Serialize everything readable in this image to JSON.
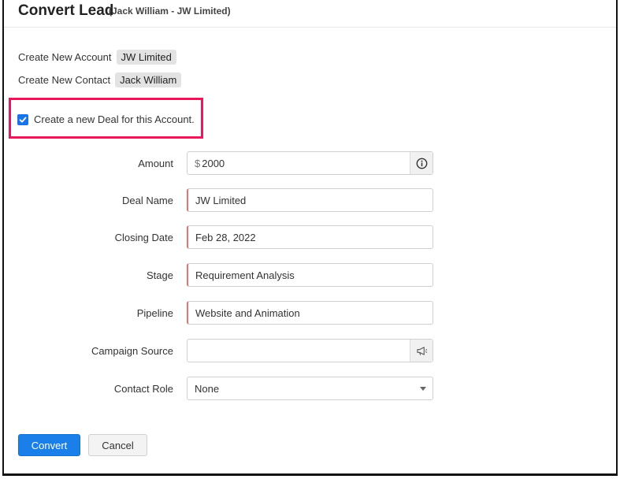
{
  "header": {
    "title": "Convert Lead",
    "subtitle": "(Jack William - JW Limited)"
  },
  "summary": {
    "account_label": "Create New Account",
    "account_value": "JW Limited",
    "contact_label": "Create New Contact",
    "contact_value": "Jack William"
  },
  "deal_option": {
    "label": "Create a new Deal for this Account.",
    "checked": true
  },
  "form": {
    "amount": {
      "label": "Amount",
      "currency": "$",
      "value": "2000",
      "icon": "info-icon"
    },
    "deal_name": {
      "label": "Deal Name",
      "value": "JW Limited"
    },
    "closing_date": {
      "label": "Closing Date",
      "value": "Feb 28, 2022"
    },
    "stage": {
      "label": "Stage",
      "value": "Requirement Analysis"
    },
    "pipeline": {
      "label": "Pipeline",
      "value": "Website and Animation"
    },
    "campaign_source": {
      "label": "Campaign Source",
      "value": "",
      "icon": "megaphone-icon"
    },
    "contact_role": {
      "label": "Contact Role",
      "value": "None"
    }
  },
  "actions": {
    "convert_label": "Convert",
    "cancel_label": "Cancel"
  },
  "colors": {
    "primary": "#1a7fe8",
    "highlight": "#e8185a",
    "required": "#e57373"
  }
}
